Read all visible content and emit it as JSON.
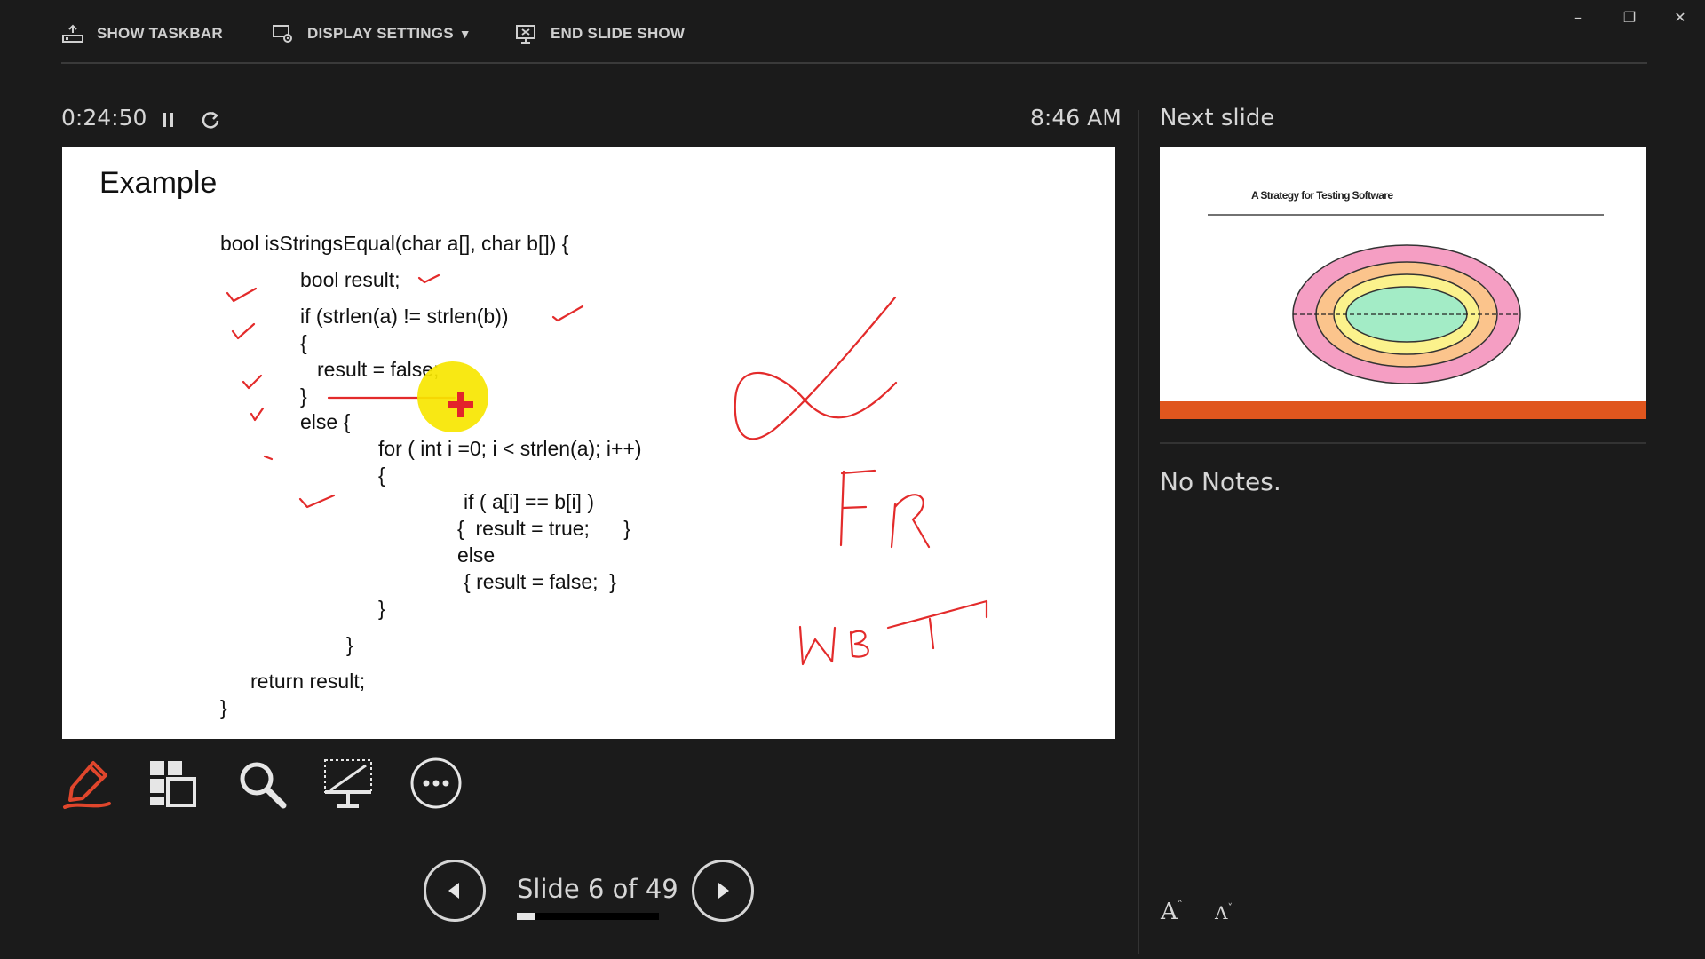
{
  "toolbar": {
    "show_taskbar": "SHOW TASKBAR",
    "display_settings": "DISPLAY SETTINGS",
    "end_slide_show": "END SLIDE SHOW"
  },
  "window": {
    "minimize": "–",
    "restore": "❐",
    "close": "✕"
  },
  "presenter": {
    "elapsed": "0:24:50",
    "clock": "8:46 AM",
    "next_slide_label": "Next slide",
    "notes": "No Notes."
  },
  "current_slide": {
    "title": "Example",
    "code_lines": [
      "bool isStringsEqual(char a[], char b[]) {",
      "bool result;",
      "if (strlen(a) != strlen(b))",
      "{",
      "result = false;",
      "}",
      "else {",
      "for ( int i =0; i < strlen(a); i++)",
      "{",
      "if ( a[i] == b[i] )",
      "{  result = true;      }",
      "else",
      "{ result = false;  }",
      "}",
      "}",
      "return result;",
      "}"
    ]
  },
  "next_slide": {
    "title": "A Strategy for Testing Software"
  },
  "navigation": {
    "slide_label": "Slide 6 of 49",
    "current": 6,
    "total": 49
  },
  "colors": {
    "ink": "#e32b2b",
    "pen_accent": "#e0462c",
    "laser": "#f7e600",
    "thumb_bar": "#e0561e"
  },
  "icons": [
    "taskbar-icon",
    "display-settings-icon",
    "end-show-icon",
    "pause-icon",
    "restart-icon",
    "pen-icon",
    "slide-grid-icon",
    "zoom-icon",
    "screen-icon",
    "more-icon",
    "prev-icon",
    "next-icon"
  ]
}
